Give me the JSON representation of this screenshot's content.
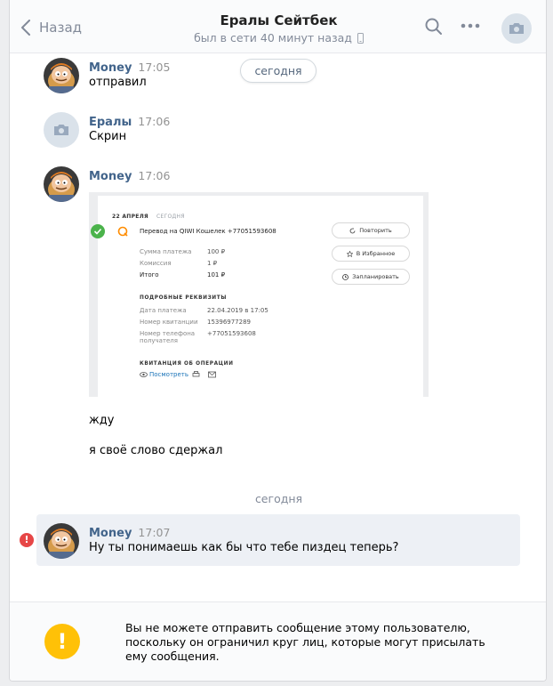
{
  "header": {
    "back_label": "Назад",
    "title": "Ералы Сейтбек",
    "subtitle": "был в сети 40 минут назад"
  },
  "date_pill": "сегодня",
  "messages": [
    {
      "author": "Money",
      "time": "17:05",
      "text": "отправил"
    },
    {
      "author": "Ералы",
      "time": "17:06",
      "text": "Скрин"
    },
    {
      "author": "Money",
      "time": "17:06"
    }
  ],
  "receipt": {
    "date": "22 АПРЕЛЯ",
    "today": "СЕГОДНЯ",
    "transfer": "Перевод на QIWI Кошелек +77051593608",
    "rows": [
      {
        "label": "Сумма платежа",
        "value": "100 ₽"
      },
      {
        "label": "Комиссия",
        "value": "1 ₽"
      },
      {
        "label": "Итого",
        "value": "101 ₽"
      }
    ],
    "details_title": "ПОДРОБНЫЕ РЕКВИЗИТЫ",
    "details": [
      {
        "label": "Дата платежа",
        "value": "22.04.2019 в 17:05"
      },
      {
        "label": "Номер квитанции",
        "value": "15396977289"
      },
      {
        "label": "Номер телефона",
        "label2": "получателя",
        "value": "+77051593608"
      }
    ],
    "receipt_title": "КВИТАНЦИЯ ОБ ОПЕРАЦИИ",
    "view_link": "Посмотреть",
    "buttons": [
      "Повторить",
      "В Избранное",
      "Запланировать"
    ]
  },
  "followups": [
    "жду",
    "я своё слово сдержал"
  ],
  "divider": "сегодня",
  "last_message": {
    "author": "Money",
    "time": "17:07",
    "text": "Ну ты понимаешь как бы что тебе пиздец теперь?"
  },
  "footer": {
    "notice": "Вы не можете отправить сообщение этому пользователю, поскольку он ограничил круг лиц, которые могут присылать ему сообщения."
  },
  "colors": {
    "author": "#42648b",
    "accent_warn": "#ffc107",
    "error": "#e64646",
    "highlight": "#edf0f5"
  }
}
